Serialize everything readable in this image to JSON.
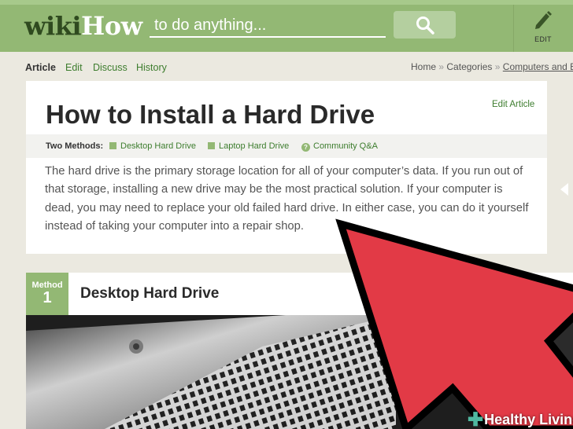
{
  "header": {
    "logo_wiki": "wiki",
    "logo_how": "How",
    "search_placeholder": "to do anything...",
    "edit_label": "EDIT"
  },
  "tabs": [
    {
      "label": "Article",
      "active": true
    },
    {
      "label": "Edit",
      "active": false
    },
    {
      "label": "Discuss",
      "active": false
    },
    {
      "label": "History",
      "active": false
    }
  ],
  "breadcrumb": {
    "home": "Home",
    "sep": "»",
    "categories": "Categories",
    "current": "Computers and Ele"
  },
  "article": {
    "edit_link": "Edit Article",
    "title": "How to Install a Hard Drive",
    "methods_lead": "Two Methods:",
    "methods": [
      "Desktop Hard Drive",
      "Laptop Hard Drive",
      "Community Q&A"
    ],
    "intro": "The hard drive is the primary storage location for all of your computer’s data. If you run out of that storage, installing a new drive may be the most practical solution. If your computer is dead, you may need to replace your old failed hard drive. In either case, you can do it yourself instead of taking your computer into a repair shop."
  },
  "method": {
    "word": "Method",
    "number": "1",
    "title": "Desktop Hard Drive"
  },
  "watermark": {
    "text": "Healthy Living"
  },
  "colors": {
    "brand_green": "#93b874",
    "link_green": "#3d7d2e",
    "arrow_red": "#e23a46",
    "background": "#ebe9e0"
  },
  "icons": [
    "search-icon",
    "pencil-icon",
    "chevron-left-icon",
    "question-icon",
    "plus-icon"
  ]
}
